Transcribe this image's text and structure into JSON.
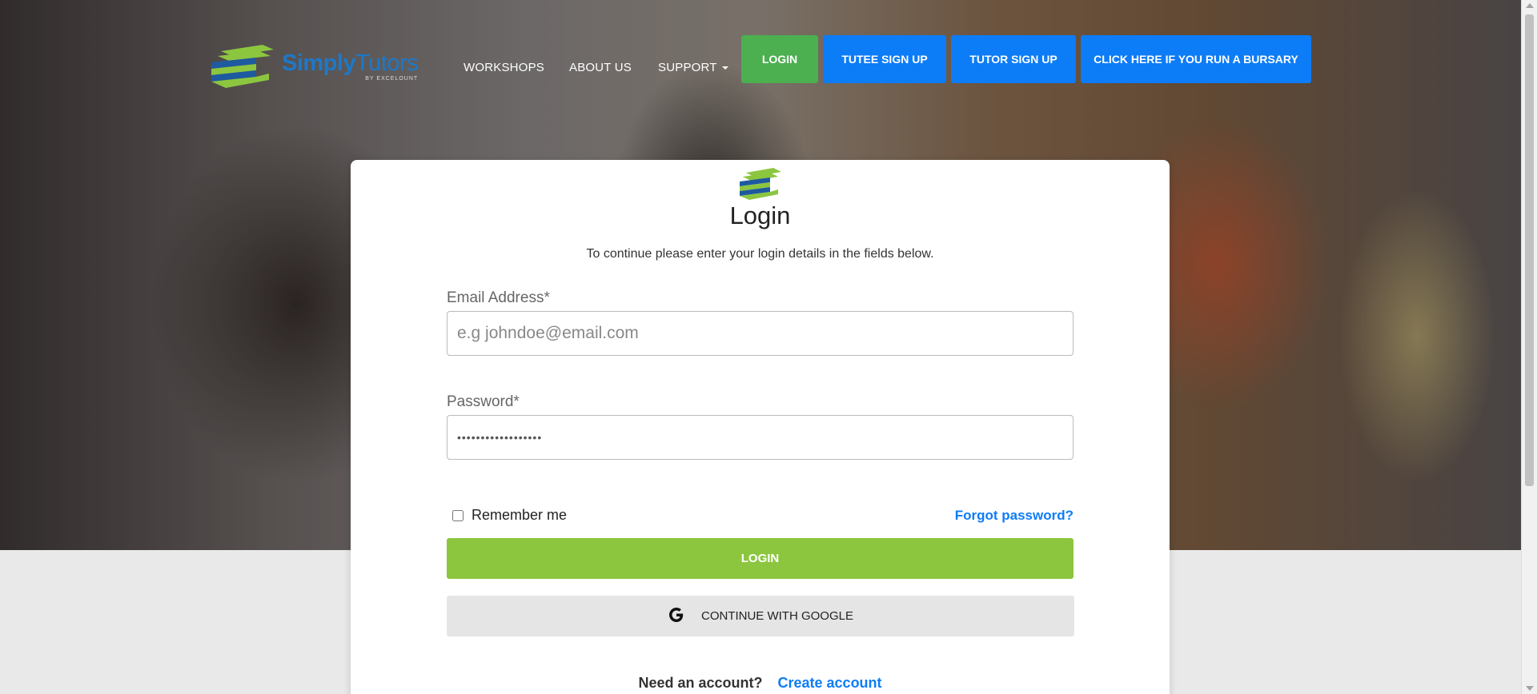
{
  "header": {
    "logo": {
      "brand_bold": "Simply",
      "brand_light": "Tutors",
      "tagline": "BY EXCELOUNT"
    },
    "nav": {
      "workshops": "WORKSHOPS",
      "about": "ABOUT US",
      "support": "SUPPORT"
    },
    "buttons": {
      "login": "LOGIN",
      "tutee_signup": "TUTEE SIGN UP",
      "tutor_signup": "TUTOR SIGN UP",
      "bursary": "CLICK HERE IF YOU RUN A BURSARY"
    }
  },
  "login_card": {
    "title": "Login",
    "subtitle": "To continue please enter your login details in the fields below.",
    "email": {
      "label": "Email Address*",
      "placeholder": "e.g johndoe@email.com",
      "value": ""
    },
    "password": {
      "label": "Password*",
      "value": "••••••••••••••••••"
    },
    "remember_label": "Remember me",
    "forgot_label": "Forgot password?",
    "login_button": "LOGIN",
    "google_button": "CONTINUE WITH GOOGLE",
    "need_account": "Need an account?",
    "create_account": "Create account"
  },
  "colors": {
    "green": "#8cc63f",
    "blue": "#0d7cf7",
    "nav_green": "#4caf50"
  }
}
